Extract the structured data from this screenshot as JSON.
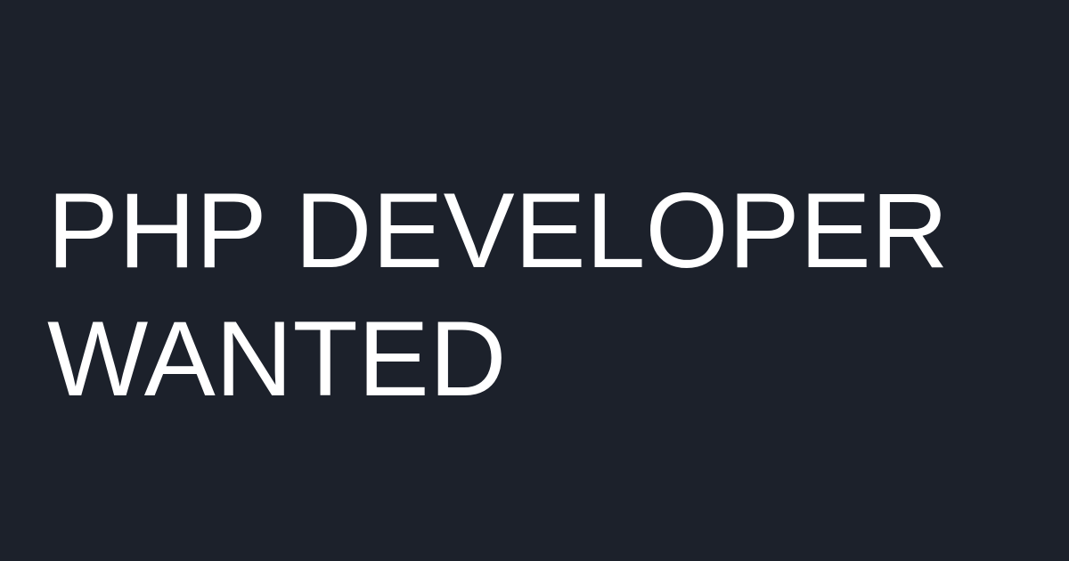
{
  "card": {
    "background_color": "#1c212b",
    "text_color": "#ffffff",
    "headline": {
      "line1": "PHP DEVELOPER",
      "line2": "WANTED"
    }
  }
}
